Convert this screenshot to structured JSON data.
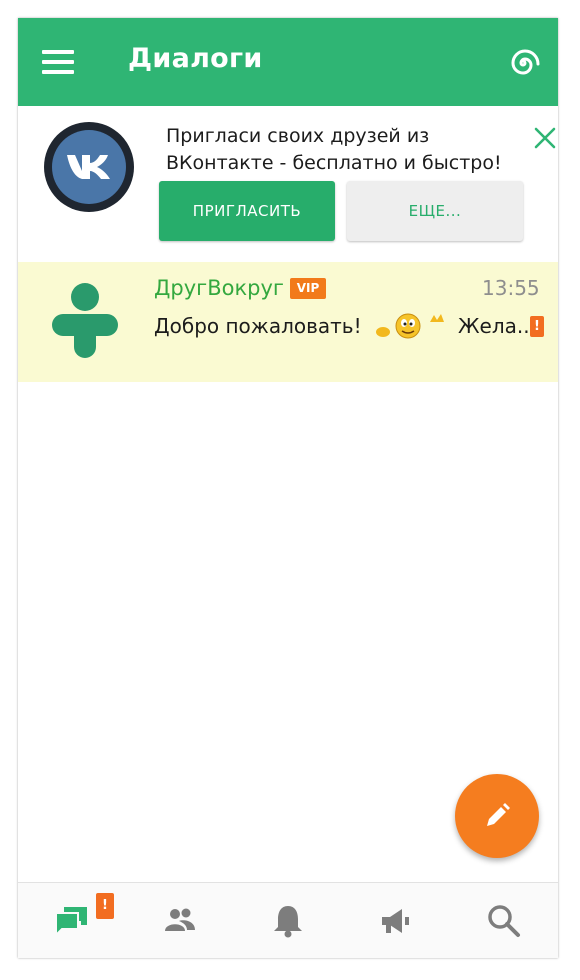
{
  "app_bar": {
    "title": "Диалоги",
    "menu_icon": "hamburger-menu-icon",
    "action_icon": "spiral-logo-icon",
    "color": "#2fb574"
  },
  "invite_banner": {
    "avatar_icon": "vk-logo-icon",
    "message": "Пригласи своих друзей из ВКонтакте - бесплатно и быстро!",
    "invite_label": "ПРИГЛАСИТЬ",
    "more_label": "ЕЩЕ...",
    "close_icon": "close-icon"
  },
  "dialogs": [
    {
      "name": "ДругВокруг",
      "badge": "VIP",
      "time": "13:55",
      "preview_start": "Добро пожаловать!",
      "preview_end": "Жела...",
      "unread": "!",
      "highlight_color": "#fafad2",
      "name_color": "#34a83f"
    }
  ],
  "fab": {
    "icon": "pencil-icon",
    "color": "#f57d1f"
  },
  "bottom_nav": {
    "items": [
      {
        "icon": "chat-bubbles-icon",
        "badge": "!",
        "active": true
      },
      {
        "icon": "people-icon"
      },
      {
        "icon": "bell-icon"
      },
      {
        "icon": "megaphone-icon"
      },
      {
        "icon": "search-icon"
      }
    ],
    "active_color": "#2fb574",
    "inactive_color": "#7d7d7d"
  }
}
